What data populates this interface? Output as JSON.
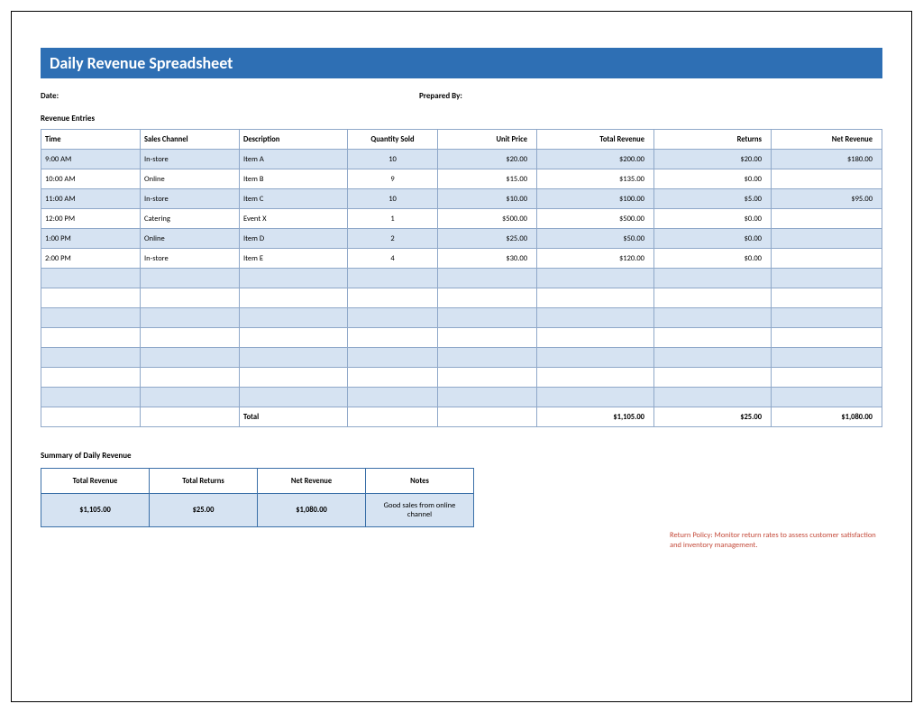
{
  "title": "Daily Revenue Spreadsheet",
  "meta": {
    "date_label": "Date:",
    "prepared_label": "Prepared By:"
  },
  "section_heading": "Revenue Entries",
  "columns": {
    "time": "Time",
    "channel": "Sales Channel",
    "desc": "Description",
    "qty": "Quantity Sold",
    "unit": "Unit Price",
    "total": "Total Revenue",
    "returns": "Returns",
    "net": "Net Revenue"
  },
  "rows": [
    {
      "time": "9:00 AM",
      "channel": "In-store",
      "desc": "Item A",
      "qty": "10",
      "unit": "$20.00",
      "total": "$200.00",
      "returns": "$20.00",
      "net": "$180.00"
    },
    {
      "time": "10:00 AM",
      "channel": "Online",
      "desc": "Item B",
      "qty": "9",
      "unit": "$15.00",
      "total": "$135.00",
      "returns": "$0.00",
      "net": ""
    },
    {
      "time": "11:00 AM",
      "channel": "In-store",
      "desc": "Item C",
      "qty": "10",
      "unit": "$10.00",
      "total": "$100.00",
      "returns": "$5.00",
      "net": "$95.00"
    },
    {
      "time": "12:00 PM",
      "channel": "Catering",
      "desc": "Event X",
      "qty": "1",
      "unit": "$500.00",
      "total": "$500.00",
      "returns": "$0.00",
      "net": ""
    },
    {
      "time": "1:00 PM",
      "channel": "Online",
      "desc": "Item D",
      "qty": "2",
      "unit": "$25.00",
      "total": "$50.00",
      "returns": "$0.00",
      "net": ""
    },
    {
      "time": "2:00 PM",
      "channel": "In-store",
      "desc": "Item E",
      "qty": "4",
      "unit": "$30.00",
      "total": "$120.00",
      "returns": "$0.00",
      "net": ""
    },
    {
      "time": "",
      "channel": "",
      "desc": "",
      "qty": "",
      "unit": "",
      "total": "",
      "returns": "",
      "net": ""
    },
    {
      "time": "",
      "channel": "",
      "desc": "",
      "qty": "",
      "unit": "",
      "total": "",
      "returns": "",
      "net": ""
    },
    {
      "time": "",
      "channel": "",
      "desc": "",
      "qty": "",
      "unit": "",
      "total": "",
      "returns": "",
      "net": ""
    },
    {
      "time": "",
      "channel": "",
      "desc": "",
      "qty": "",
      "unit": "",
      "total": "",
      "returns": "",
      "net": ""
    },
    {
      "time": "",
      "channel": "",
      "desc": "",
      "qty": "",
      "unit": "",
      "total": "",
      "returns": "",
      "net": ""
    },
    {
      "time": "",
      "channel": "",
      "desc": "",
      "qty": "",
      "unit": "",
      "total": "",
      "returns": "",
      "net": ""
    },
    {
      "time": "",
      "channel": "",
      "desc": "",
      "qty": "",
      "unit": "",
      "total": "",
      "returns": "",
      "net": ""
    }
  ],
  "totals": {
    "label": "Total",
    "total": "$1,105.00",
    "returns": "$25.00",
    "net": "$1,080.00"
  },
  "note_red": "Return Policy: Monitor return rates to assess customer satisfaction and inventory management.",
  "summary_heading": "Summary of Daily Revenue",
  "summary": {
    "headers": {
      "total": "Total Revenue",
      "returns": "Total Returns",
      "net": "Net Revenue",
      "notes": "Notes"
    },
    "values": {
      "total": "$1,105.00",
      "returns": "$25.00",
      "net": "$1,080.00",
      "notes": "Good sales from online channel"
    }
  },
  "chart_data": {
    "type": "table",
    "title": "Daily Revenue Spreadsheet",
    "columns": [
      "Time",
      "Sales Channel",
      "Description",
      "Quantity Sold",
      "Unit Price",
      "Total Revenue",
      "Returns",
      "Net Revenue"
    ],
    "rows": [
      [
        "9:00 AM",
        "In-store",
        "Item A",
        10,
        20.0,
        200.0,
        20.0,
        180.0
      ],
      [
        "10:00 AM",
        "Online",
        "Item B",
        9,
        15.0,
        135.0,
        0.0,
        null
      ],
      [
        "11:00 AM",
        "In-store",
        "Item C",
        10,
        10.0,
        100.0,
        5.0,
        95.0
      ],
      [
        "12:00 PM",
        "Catering",
        "Event X",
        1,
        500.0,
        500.0,
        0.0,
        null
      ],
      [
        "1:00 PM",
        "Online",
        "Item D",
        2,
        25.0,
        50.0,
        0.0,
        null
      ],
      [
        "2:00 PM",
        "In-store",
        "Item E",
        4,
        30.0,
        120.0,
        0.0,
        null
      ]
    ],
    "totals": {
      "Total Revenue": 1105.0,
      "Returns": 25.0,
      "Net Revenue": 1080.0
    }
  }
}
